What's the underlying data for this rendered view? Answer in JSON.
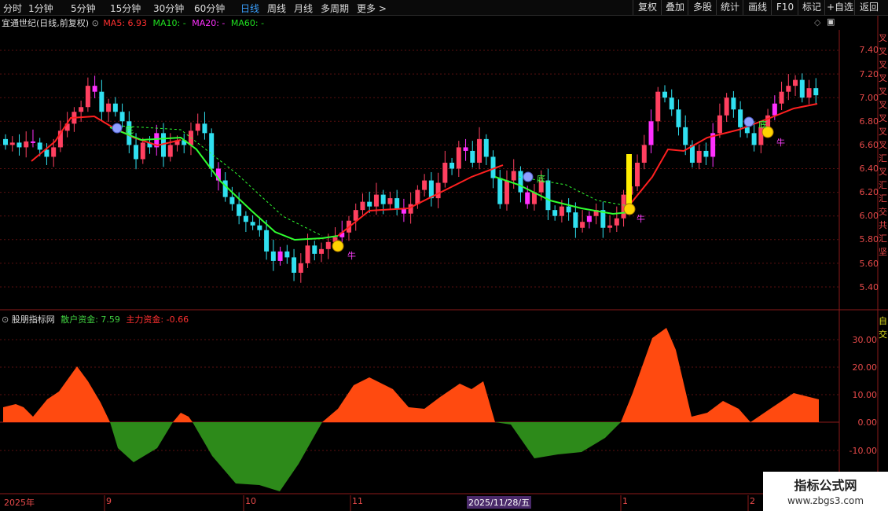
{
  "topbar": {
    "periods": [
      "分时",
      "1分钟",
      "5分钟",
      "15分钟",
      "30分钟",
      "60分钟",
      "日线",
      "周线",
      "月线",
      "多周期",
      "更多 >"
    ],
    "active_period": "日线",
    "right_buttons": [
      "复权",
      "叠加",
      "多股",
      "统计",
      "画线",
      "F10",
      "标记",
      "+自选",
      "返回"
    ]
  },
  "main_chart": {
    "stock_title": "宜通世纪(日线,前复权)",
    "ma_labels": [
      {
        "text": "MA5: 6.93",
        "color": "#ff3030"
      },
      {
        "text": "MA10: -",
        "color": "#20e020"
      },
      {
        "text": "MA20: -",
        "color": "#ff30ff"
      },
      {
        "text": "MA60: -",
        "color": "#20e020"
      }
    ],
    "price_ticks": [
      "7.40",
      "7.20",
      "7.00",
      "6.80",
      "6.60",
      "6.40",
      "6.20",
      "6.00",
      "5.80",
      "5.60",
      "5.40"
    ],
    "signal_labels": [
      "底",
      "底",
      "底",
      "牛",
      "牛",
      "牛"
    ],
    "side_text": "叉叉叉叉叉叉叉叉叉汇叉汇汇交共汇坚"
  },
  "indicator_panel": {
    "name": "股朋指标网",
    "retail_label": "散户资金: 7.59",
    "main_label": "主力资金: -0.66",
    "ticks": [
      "30.00",
      "20.00",
      "10.00",
      "0.00",
      "-10.00"
    ],
    "side_text": "自交"
  },
  "date_axis": {
    "labels": [
      "2025年",
      "9",
      "10",
      "11",
      "2025/11/28/五",
      "1",
      "2"
    ]
  },
  "watermark": {
    "line1": "指标公式网",
    "line2": "www.zbgs3.com"
  }
}
